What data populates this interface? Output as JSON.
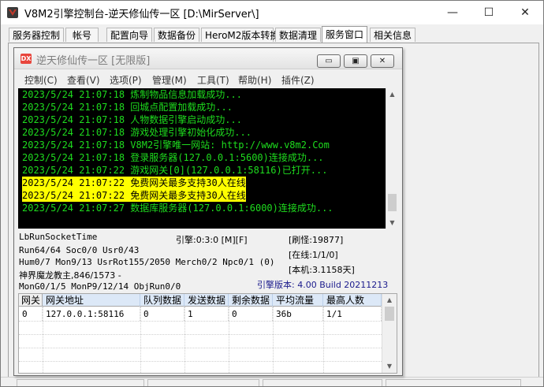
{
  "window": {
    "title": "V8M2引擎控制台-逆天修仙传一区 [D:\\MirServer\\]",
    "minimize_glyph": "—",
    "maximize_glyph": "☐",
    "close_glyph": "✕"
  },
  "tabs": [
    {
      "label": "服务器控制"
    },
    {
      "label": "帐号"
    },
    {
      "label": "配置向导"
    },
    {
      "label": "数据备份"
    },
    {
      "label": "HeroM2版本转换"
    },
    {
      "label": "数据清理"
    },
    {
      "label": "服务窗口"
    },
    {
      "label": "相关信息"
    }
  ],
  "active_tab": "服务窗口",
  "server_window": {
    "icon_text": "DX",
    "title": "逆天修仙传一区 [无限版]",
    "buttons": {
      "minimize": "▭",
      "restore": "▣",
      "close": "✕"
    },
    "menu": [
      {
        "label": "控制(C)"
      },
      {
        "label": "查看(V)"
      },
      {
        "label": "选项(P)"
      },
      {
        "label": "管理(M)"
      },
      {
        "label": "工具(T)"
      },
      {
        "label": "帮助(H)"
      },
      {
        "label": "插件(Z)"
      }
    ],
    "log": [
      {
        "text": "2023/5/24 21:07:18 炼制物品信息加载成功...",
        "highlight": false
      },
      {
        "text": "2023/5/24 21:07:18 回城点配置加载成功...",
        "highlight": false
      },
      {
        "text": "2023/5/24 21:07:18 人物数据引擎启动成功...",
        "highlight": false
      },
      {
        "text": "2023/5/24 21:07:18 游戏处理引擎初始化成功...",
        "highlight": false
      },
      {
        "text": "2023/5/24 21:07:18 V8M2引擎唯一网站: http://www.v8m2.Com",
        "highlight": false
      },
      {
        "text": "2023/5/24 21:07:18 登录服务器(127.0.0.1:5600)连接成功...",
        "highlight": false
      },
      {
        "text": "2023/5/24 21:07:22 游戏网关[0](127.0.0.1:58116)已打开...",
        "highlight": false
      },
      {
        "text": "2023/5/24 21:07:22 免费网关最多支持30人在线",
        "highlight": true
      },
      {
        "text": "2023/5/24 21:07:22 免费网关最多支持30人在线",
        "highlight": true
      },
      {
        "text": "2023/5/24 21:07:27 数据库服务器(127.0.0.1:6000)连接成功...",
        "highlight": false
      }
    ],
    "status": {
      "lb_run_socket_time": "LbRunSocketTime",
      "engine": "引擎:0:3:0 [M][F]",
      "refresh": "[刷怪:19877]",
      "run": "Run64/64 Soc0/0 Usr0/43",
      "online": "[在线:1/1/0]",
      "hum": "Hum0/7 Mon9/13 UsrRot155/2050 Merch0/2 Npc0/1 (0)",
      "local": "[本机:3.1158天]",
      "boss": "神界魔龙教主,846/1573 -",
      "mon": "MonG0/1/5 MonP9/12/14 ObjRun0/0",
      "version": "引擎版本: 4.00 Build 20211213"
    },
    "gateway_table": {
      "columns": [
        "网关",
        "网关地址",
        "队列数据",
        "发送数据",
        "剩余数据",
        "平均流量",
        "最高人数"
      ],
      "rows": [
        [
          "0",
          "127.0.0.1:58116",
          "0",
          "1",
          "0",
          "36b",
          "1/1"
        ]
      ]
    }
  }
}
